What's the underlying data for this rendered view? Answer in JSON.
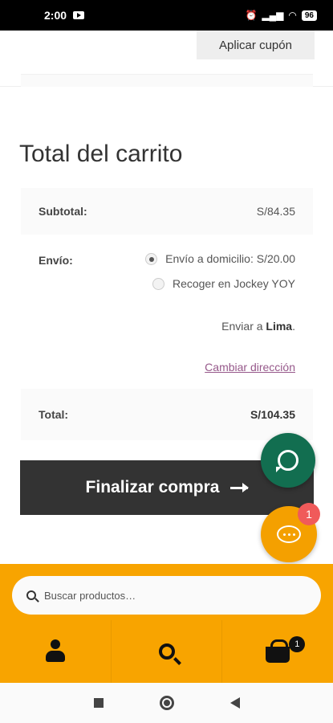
{
  "status_bar": {
    "time": "2:00",
    "battery": "96"
  },
  "coupon": {
    "apply_label": "Aplicar cupón"
  },
  "cart_totals": {
    "title": "Total del carrito",
    "subtotal_label": "Subtotal:",
    "subtotal_value": "S/84.35",
    "shipping_label": "Envío:",
    "shipping_options": [
      {
        "label": "Envío a domicilio: S/20.00",
        "selected": true
      },
      {
        "label": "Recoger en Jockey YOY",
        "selected": false
      }
    ],
    "ship_to_prefix": "Enviar a",
    "ship_to_city": "Lima",
    "ship_to_suffix": ".",
    "change_address": "Cambiar dirección",
    "total_label": "Total:",
    "total_value": "S/104.35"
  },
  "checkout": {
    "label": "Finalizar compra"
  },
  "chat": {
    "badge": "1"
  },
  "search": {
    "placeholder": "Buscar productos…"
  },
  "cart": {
    "badge": "1"
  },
  "colors": {
    "accent": "#f8a400",
    "button_dark": "#333333",
    "whatsapp": "#126e50",
    "link": "#96588a"
  }
}
